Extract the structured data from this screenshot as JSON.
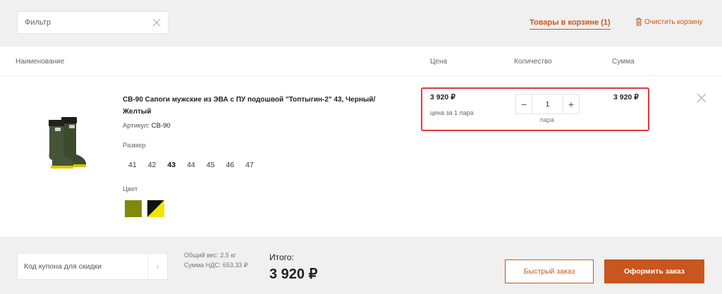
{
  "filter": {
    "placeholder": "Фильтр"
  },
  "header_links": {
    "cart_label": "Товары в корзине (1)",
    "clear_label": "Очистить корзину"
  },
  "columns": {
    "name": "Наименование",
    "price": "Цена",
    "quantity": "Количество",
    "sum": "Сумма"
  },
  "item": {
    "title": "СВ-90 Сапоги мужские из ЭВА с ПУ подошвой \"Топтыгин-2\" 43, Черный/ Желтый",
    "sku_label": "Артикул:",
    "sku_value": "СВ-90",
    "size_label": "Размер",
    "sizes": [
      "41",
      "42",
      "43",
      "44",
      "45",
      "46",
      "47"
    ],
    "selected_size": "43",
    "color_label": "Цвет",
    "colors": [
      "#7f8a0a",
      "black/yellow"
    ],
    "price": "3 920 ₽",
    "price_note": "цена за 1 пара",
    "quantity": "1",
    "unit": "пара",
    "sum": "3 920 ₽"
  },
  "footer": {
    "coupon_placeholder": "Код купона для скидки",
    "weight": "Общий вес: 2.5 кг",
    "vat": "Сумма НДС: 653.33 ₽",
    "total_label": "Итого:",
    "total_value": "3 920 ₽",
    "quick_order": "Быстрый заказ",
    "checkout": "Оформить заказ"
  },
  "colors": {
    "accent": "#c8561e",
    "highlight": "#e0393b"
  }
}
